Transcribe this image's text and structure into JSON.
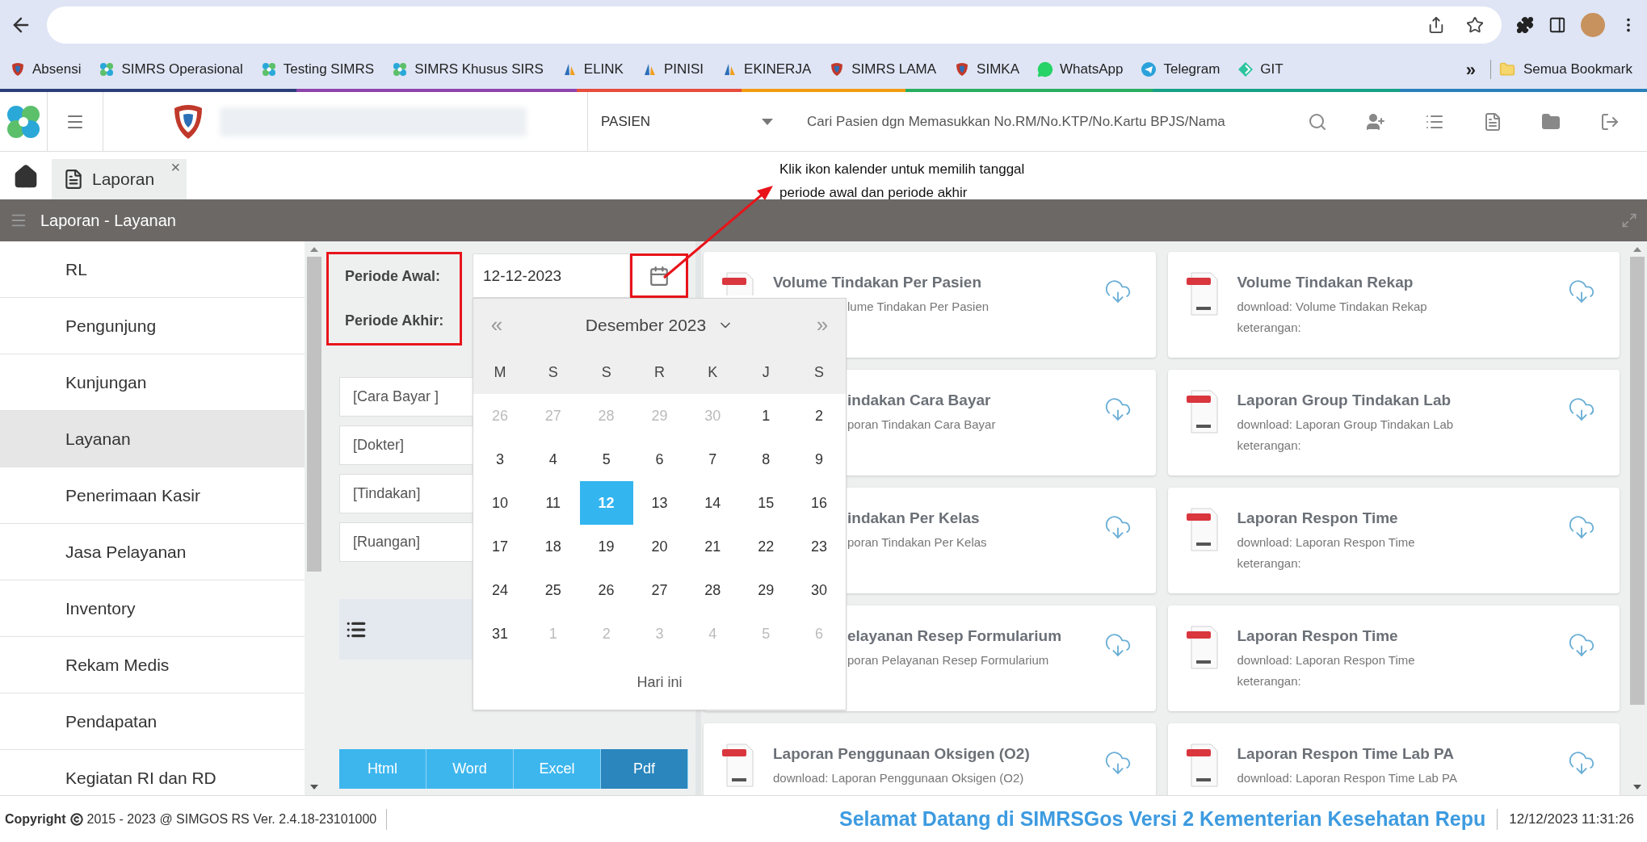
{
  "browser": {
    "bookmarks": [
      {
        "label": "Absensi",
        "kind": "shield"
      },
      {
        "label": "SIMRS Operasional",
        "kind": "flower"
      },
      {
        "label": "Testing SIMRS",
        "kind": "flower"
      },
      {
        "label": "SIMRS Khusus SIRS",
        "kind": "flower"
      },
      {
        "label": "ELINK",
        "kind": "sail"
      },
      {
        "label": "PINISI",
        "kind": "sail"
      },
      {
        "label": "EKINERJA",
        "kind": "sail"
      },
      {
        "label": "SIMRS LAMA",
        "kind": "shield"
      },
      {
        "label": "SIMKA",
        "kind": "shield"
      },
      {
        "label": "WhatsApp",
        "kind": "chat"
      },
      {
        "label": "Telegram",
        "kind": "plane"
      },
      {
        "label": "GIT",
        "kind": "diamond"
      }
    ],
    "more": "»",
    "all_bookmarks": "Semua Bookmark"
  },
  "header": {
    "patient_dropdown": "PASIEN",
    "search": {
      "placeholder": "Cari Pasien dgn Memasukkan No.RM/No.KTP/No.Kartu BPJS/Nama"
    }
  },
  "tabs": [
    {
      "label": "Laporan",
      "close": "×",
      "selected": true
    }
  ],
  "annotation": "Klik ikon kalender untuk memilih tanggal periode awal dan periode akhir",
  "title_bar": "Laporan - Layanan",
  "sidebar": {
    "items": [
      {
        "label": "RL",
        "selected": false
      },
      {
        "label": "Pengunjung",
        "selected": false
      },
      {
        "label": "Kunjungan",
        "selected": false
      },
      {
        "label": "Layanan",
        "selected": true
      },
      {
        "label": "Penerimaan Kasir",
        "selected": false
      },
      {
        "label": "Jasa Pelayanan",
        "selected": false
      },
      {
        "label": "Inventory",
        "selected": false
      },
      {
        "label": "Rekam Medis",
        "selected": false
      },
      {
        "label": "Pendapatan",
        "selected": false
      },
      {
        "label": "Kegiatan RI dan RD",
        "selected": false
      }
    ]
  },
  "form": {
    "labels": [
      "Periode Awal:",
      "Periode Akhir:"
    ],
    "start_date": "12-12-2023",
    "selects": [
      "[Cara Bayar ]",
      "[Dokter]",
      "[Tindakan]",
      "[Ruangan]"
    ],
    "formats": [
      {
        "label": "Html",
        "selected": false
      },
      {
        "label": "Word",
        "selected": false
      },
      {
        "label": "Excel",
        "selected": false
      },
      {
        "label": "Pdf",
        "selected": true
      }
    ]
  },
  "calendar": {
    "month": "Desember 2023",
    "prev": "«",
    "next": "»",
    "weekdays": [
      "M",
      "S",
      "S",
      "R",
      "K",
      "J",
      "S"
    ],
    "days": [
      {
        "label": "26",
        "muted": true,
        "selected": false
      },
      {
        "label": "27",
        "muted": true,
        "selected": false
      },
      {
        "label": "28",
        "muted": true,
        "selected": false
      },
      {
        "label": "29",
        "muted": true,
        "selected": false
      },
      {
        "label": "30",
        "muted": true,
        "selected": false
      },
      {
        "label": "1",
        "muted": false,
        "selected": false
      },
      {
        "label": "2",
        "muted": false,
        "selected": false
      },
      {
        "label": "3",
        "muted": false,
        "selected": false
      },
      {
        "label": "4",
        "muted": false,
        "selected": false
      },
      {
        "label": "5",
        "muted": false,
        "selected": false
      },
      {
        "label": "6",
        "muted": false,
        "selected": false
      },
      {
        "label": "7",
        "muted": false,
        "selected": false
      },
      {
        "label": "8",
        "muted": false,
        "selected": false
      },
      {
        "label": "9",
        "muted": false,
        "selected": false
      },
      {
        "label": "10",
        "muted": false,
        "selected": false
      },
      {
        "label": "11",
        "muted": false,
        "selected": false
      },
      {
        "label": "12",
        "muted": false,
        "selected": true
      },
      {
        "label": "13",
        "muted": false,
        "selected": false
      },
      {
        "label": "14",
        "muted": false,
        "selected": false
      },
      {
        "label": "15",
        "muted": false,
        "selected": false
      },
      {
        "label": "16",
        "muted": false,
        "selected": false
      },
      {
        "label": "17",
        "muted": false,
        "selected": false
      },
      {
        "label": "18",
        "muted": false,
        "selected": false
      },
      {
        "label": "19",
        "muted": false,
        "selected": false
      },
      {
        "label": "20",
        "muted": false,
        "selected": false
      },
      {
        "label": "21",
        "muted": false,
        "selected": false
      },
      {
        "label": "22",
        "muted": false,
        "selected": false
      },
      {
        "label": "23",
        "muted": false,
        "selected": false
      },
      {
        "label": "24",
        "muted": false,
        "selected": false
      },
      {
        "label": "25",
        "muted": false,
        "selected": false
      },
      {
        "label": "26",
        "muted": false,
        "selected": false
      },
      {
        "label": "27",
        "muted": false,
        "selected": false
      },
      {
        "label": "28",
        "muted": false,
        "selected": false
      },
      {
        "label": "29",
        "muted": false,
        "selected": false
      },
      {
        "label": "30",
        "muted": false,
        "selected": false
      },
      {
        "label": "31",
        "muted": false,
        "selected": false
      },
      {
        "label": "1",
        "muted": true,
        "selected": false
      },
      {
        "label": "2",
        "muted": true,
        "selected": false
      },
      {
        "label": "3",
        "muted": true,
        "selected": false
      },
      {
        "label": "4",
        "muted": true,
        "selected": false
      },
      {
        "label": "5",
        "muted": true,
        "selected": false
      },
      {
        "label": "6",
        "muted": true,
        "selected": false
      }
    ],
    "today": "Hari ini"
  },
  "reports": [
    {
      "kind": "partial",
      "title": "Volume Tindakan Per Pasien",
      "description": "lume Tindakan Per Pasien"
    },
    {
      "kind": "full",
      "title": "Volume Tindakan Rekap",
      "description": "download: Volume Tindakan Rekap",
      "note": "keterangan:"
    },
    {
      "kind": "covered",
      "title": "indakan Cara Bayar",
      "description": "poran Tindakan Cara Bayar"
    },
    {
      "kind": "full",
      "title": "Laporan Group Tindakan Lab",
      "description": "download: Laporan Group Tindakan Lab",
      "note": "keterangan:"
    },
    {
      "kind": "covered",
      "title": "indakan Per Kelas",
      "description": "poran Tindakan Per Kelas"
    },
    {
      "kind": "full",
      "title": "Laporan Respon Time",
      "description": "download: Laporan Respon Time",
      "note": "keterangan:"
    },
    {
      "kind": "covered",
      "title": "elayanan Resep Formularium",
      "description": "poran Pelayanan Resep Formularium"
    },
    {
      "kind": "full",
      "title": "Laporan Respon Time",
      "description": "download: Laporan Respon Time",
      "note": "keterangan:"
    },
    {
      "kind": "full",
      "title": "Laporan Penggunaan Oksigen (O2)",
      "description": "download: Laporan Penggunaan Oksigen (O2)"
    },
    {
      "kind": "full",
      "title": "Laporan Respon Time Lab PA",
      "description": "download: Laporan Respon Time Lab PA"
    }
  ],
  "footer": {
    "copyright_label": "Copyright",
    "copyright_text": "2015 - 2023 @ SIMGOS RS Ver. 2.4.18-23101000",
    "marquee": "Selamat Datang di SIMRSGos Versi 2 Kementerian Kesehatan Repu",
    "datetime": "12/12/2023 11:31:26"
  }
}
